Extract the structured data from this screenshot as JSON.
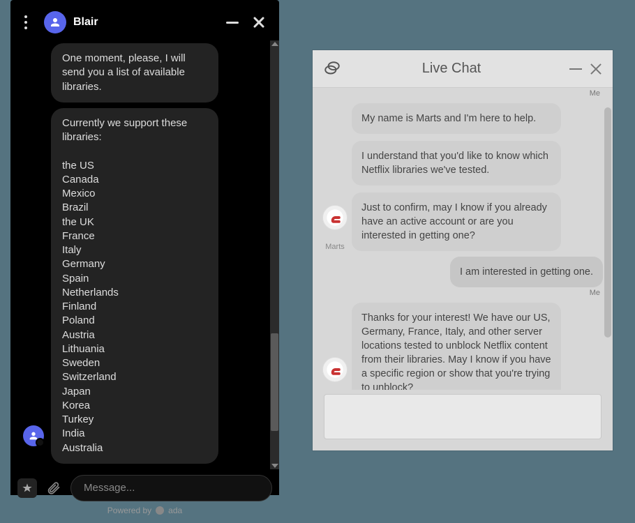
{
  "dark_chat": {
    "agent_name": "Blair",
    "bubbles": [
      "One moment, please, I will send you a list of available libraries.",
      "Currently we support these libraries:\n\nthe US\nCanada\nMexico\nBrazil\nthe UK\nFrance\nItaly\nGermany\nSpain\nNetherlands\nFinland\nPoland\nAustria\nLithuania\nSweden\nSwitzerland\nJapan\nKorea\nTurkey\nIndia\nAustralia"
    ],
    "input_placeholder": "Message...",
    "powered_by_prefix": "Powered by",
    "powered_by_name": "ada"
  },
  "light_chat": {
    "title": "Live Chat",
    "me_label": "Me",
    "agent_name": "Marts",
    "agent_group_1": [
      "My name is Marts and I'm here to help.",
      "I understand that you'd like to know which Netflix libraries we've tested.",
      "Just to confirm, may I know if you already have an active account or are you interested in getting one?"
    ],
    "user_msg_1": "I am interested in getting one.",
    "agent_group_2": [
      "Thanks for your interest! We have our US, Germany, France, Italy, and other server locations tested to unblock Netflix content from their libraries. May I know if you have a specific region or show that you're trying to unblock?"
    ]
  }
}
